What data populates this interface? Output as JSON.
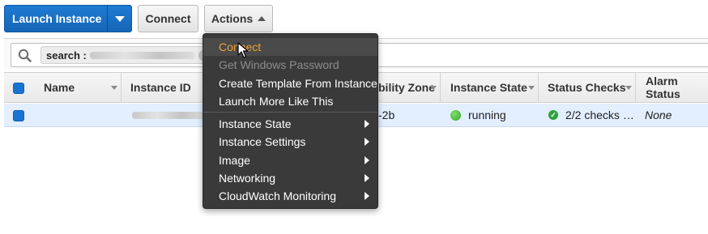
{
  "toolbar": {
    "launch_label": "Launch Instance",
    "connect_label": "Connect",
    "actions_label": "Actions"
  },
  "search": {
    "token_label": "search :"
  },
  "table": {
    "columns": [
      "Name",
      "Instance ID",
      "bility Zone",
      "Instance State",
      "Status Checks",
      "Alarm Status"
    ],
    "row": {
      "name": "",
      "zone": "-2b",
      "state": "running",
      "status_checks": "2/2 checks …",
      "alarm_status": "None"
    }
  },
  "menu": {
    "items": [
      {
        "label": "Connect",
        "state": "hover",
        "submenu": false
      },
      {
        "label": "Get Windows Password",
        "state": "disabled",
        "submenu": false
      },
      {
        "label": "Create Template From Instance",
        "state": "normal",
        "submenu": false
      },
      {
        "label": "Launch More Like This",
        "state": "normal",
        "submenu": false
      },
      {
        "label": "Instance State",
        "state": "normal",
        "submenu": true
      },
      {
        "label": "Instance Settings",
        "state": "normal",
        "submenu": true
      },
      {
        "label": "Image",
        "state": "normal",
        "submenu": true
      },
      {
        "label": "Networking",
        "state": "normal",
        "submenu": true
      },
      {
        "label": "CloudWatch Monitoring",
        "state": "normal",
        "submenu": true
      }
    ]
  },
  "colors": {
    "primary": "#1a73d1",
    "menu_bg": "#3a3a3a",
    "menu_hover_text": "#f0a33b",
    "running": "#3aa52a",
    "row_selected": "#e3efff"
  },
  "icons": [
    "search-icon",
    "chevron-down-icon",
    "chevron-up-icon",
    "clear-icon",
    "status-ok-icon",
    "running-dot-icon",
    "submenu-arrow-icon",
    "cursor-icon"
  ]
}
